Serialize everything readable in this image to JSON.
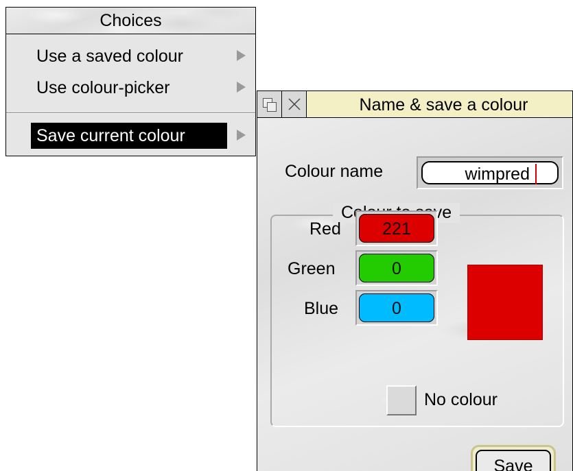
{
  "menu": {
    "title": "Choices",
    "items": [
      {
        "label": "Use a saved colour",
        "has_submenu": true,
        "selected": false
      },
      {
        "label": "Use colour-picker",
        "has_submenu": true,
        "selected": false
      },
      {
        "label": "Save current colour",
        "has_submenu": true,
        "selected": true
      }
    ]
  },
  "dialog": {
    "title": "Name & save a colour",
    "title_bar_color": "#f3f0c6",
    "colour_name_label": "Colour name",
    "colour_name_value": "wimpred",
    "group_title": "Colour to save",
    "channels": [
      {
        "label": "Red",
        "value": "221",
        "color": "#dd0000"
      },
      {
        "label": "Green",
        "value": "0",
        "color": "#22cc00"
      },
      {
        "label": "Blue",
        "value": "0",
        "color": "#00bbff"
      }
    ],
    "swatch_color": "#dd0000",
    "no_colour_label": "No colour",
    "no_colour_checked": false,
    "save_label": "Save"
  }
}
